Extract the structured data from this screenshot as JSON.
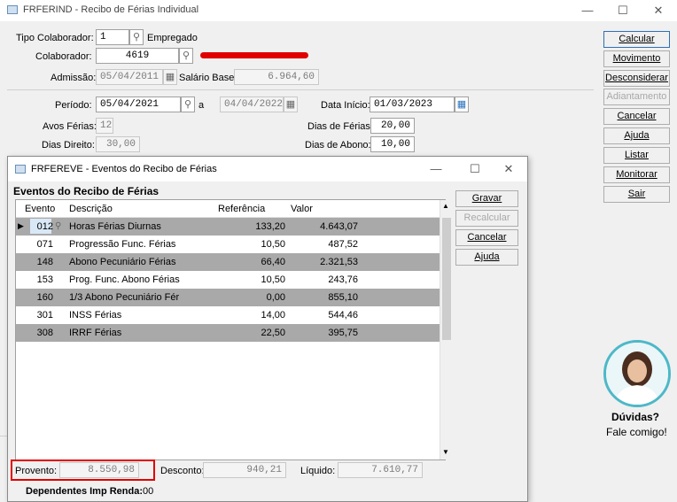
{
  "window": {
    "title": "FRFERIND - Recibo de Férias Individual",
    "min": "—",
    "max": "☐",
    "close": "✕"
  },
  "form": {
    "tipo_label": "Tipo Colaborador:",
    "tipo_value": "1",
    "tipo_desc": "Empregado",
    "colab_label": "Colaborador:",
    "colab_value": "4619",
    "admissao_label": "Admissão:",
    "admissao_value": "05/04/2011",
    "salario_label": "Salário Base:",
    "salario_value": "6.964,60",
    "periodo_label": "Período:",
    "periodo_from": "05/04/2021",
    "periodo_a": "a",
    "periodo_to": "04/04/2022",
    "inicio_label": "Data Início:",
    "inicio_value": "01/03/2023",
    "avos_label": "Avos Férias:",
    "avos_value": "12",
    "dias_ferias_label": "Dias de Férias:",
    "dias_ferias_value": "20,00",
    "direito_label": "Dias Direito:",
    "direito_value": "30,00",
    "abono_label": "Dias de Abono:",
    "abono_value": "10,00"
  },
  "right_buttons": [
    "Calcular",
    "Movimento",
    "Desconsiderar",
    "Adiantamento",
    "Cancelar",
    "Ajuda",
    "Listar",
    "Monitorar",
    "Sair"
  ],
  "help": {
    "line1": "Dúvidas?",
    "line2": "Fale comigo!"
  },
  "dialog": {
    "title": "FRFEREVE - Eventos do Recibo de Férias",
    "min": "—",
    "max": "☐",
    "close": "✕",
    "heading": "Eventos do Recibo de Férias",
    "columns": [
      "Evento",
      "Descrição",
      "Referência",
      "Valor"
    ],
    "rows": [
      {
        "evento": "012",
        "descricao": "Horas Férias Diurnas",
        "referencia": "133,20",
        "valor": "4.643,07"
      },
      {
        "evento": "071",
        "descricao": "Progressão Func. Férias",
        "referencia": "10,50",
        "valor": "487,52"
      },
      {
        "evento": "148",
        "descricao": "Abono Pecuniário Férias",
        "referencia": "66,40",
        "valor": "2.321,53"
      },
      {
        "evento": "153",
        "descricao": "Prog. Func. Abono Férias",
        "referencia": "10,50",
        "valor": "243,76"
      },
      {
        "evento": "160",
        "descricao": "1/3 Abono Pecuniário Fér",
        "referencia": "0,00",
        "valor": "855,10"
      },
      {
        "evento": "301",
        "descricao": "INSS Férias",
        "referencia": "14,00",
        "valor": "544,46"
      },
      {
        "evento": "308",
        "descricao": "IRRF Férias",
        "referencia": "22,50",
        "valor": "395,75"
      }
    ],
    "buttons": [
      "Gravar",
      "Recalcular",
      "Cancelar",
      "Ajuda"
    ],
    "provento_label": "Provento:",
    "provento_value": "8.550,98",
    "desconto_label": "Desconto:",
    "desconto_value": "940,21",
    "liquido_label": "Líquido:",
    "liquido_value": "7.610,77",
    "dependentes_label": "Dependentes Imp Renda:",
    "dependentes_value": "00"
  },
  "colors": {
    "selected_row": "#a9a9a9",
    "highlight_box": "#e00000",
    "redaction": "#e00000"
  }
}
